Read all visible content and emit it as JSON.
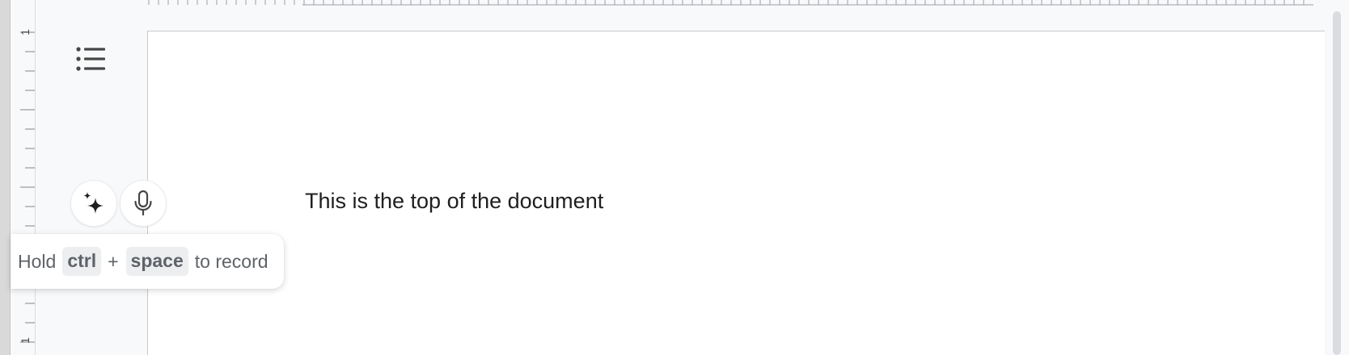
{
  "ruler": {
    "vertical_label_top": "1",
    "vertical_label_bottom": "1"
  },
  "outline_button": {
    "icon": "list-icon"
  },
  "document": {
    "text": "This is the top of the document"
  },
  "action_buttons": {
    "gemini_icon": "sparkle-icon",
    "mic_icon": "microphone-icon"
  },
  "tooltip": {
    "prefix": "Hold",
    "key1": "ctrl",
    "plus": "+",
    "key2": "space",
    "suffix": "to record"
  },
  "colors": {
    "page_background": "#ffffff",
    "canvas_background": "#f8f9fa",
    "text": "#1f1f1f",
    "tooltip_text": "#5f6368",
    "key_background": "#eceef0"
  }
}
